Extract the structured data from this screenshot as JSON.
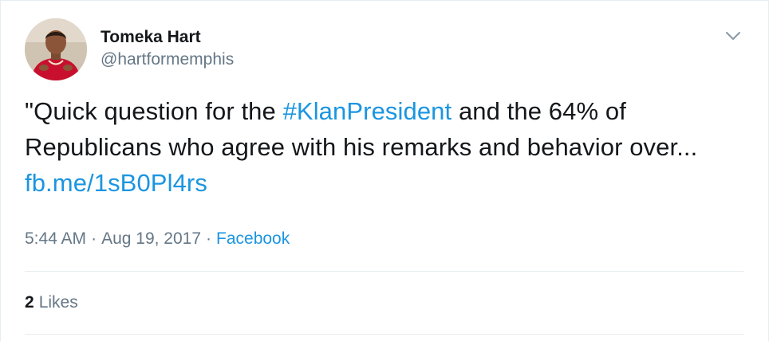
{
  "user": {
    "display_name": "Tomeka Hart",
    "handle": "@hartformemphis",
    "avatar_icon": "profile-photo"
  },
  "tweet": {
    "text_part1": "\"Quick question for the ",
    "hashtag": "#KlanPresident",
    "text_part2": " and the 64% of Republicans who agree with his remarks and behavior over... ",
    "link": "fb.me/1sB0Pl4rs"
  },
  "meta": {
    "time": "5:44 AM",
    "separator": "·",
    "date": "Aug 19, 2017",
    "source": "Facebook"
  },
  "stats": {
    "likes_count": "2",
    "likes_label": "Likes"
  },
  "colors": {
    "link": "#1b95e0",
    "secondary_text": "#657786",
    "primary_text": "#14171a",
    "divider": "#e6ecf0"
  },
  "icons": {
    "menu": "chevron-down-icon"
  }
}
